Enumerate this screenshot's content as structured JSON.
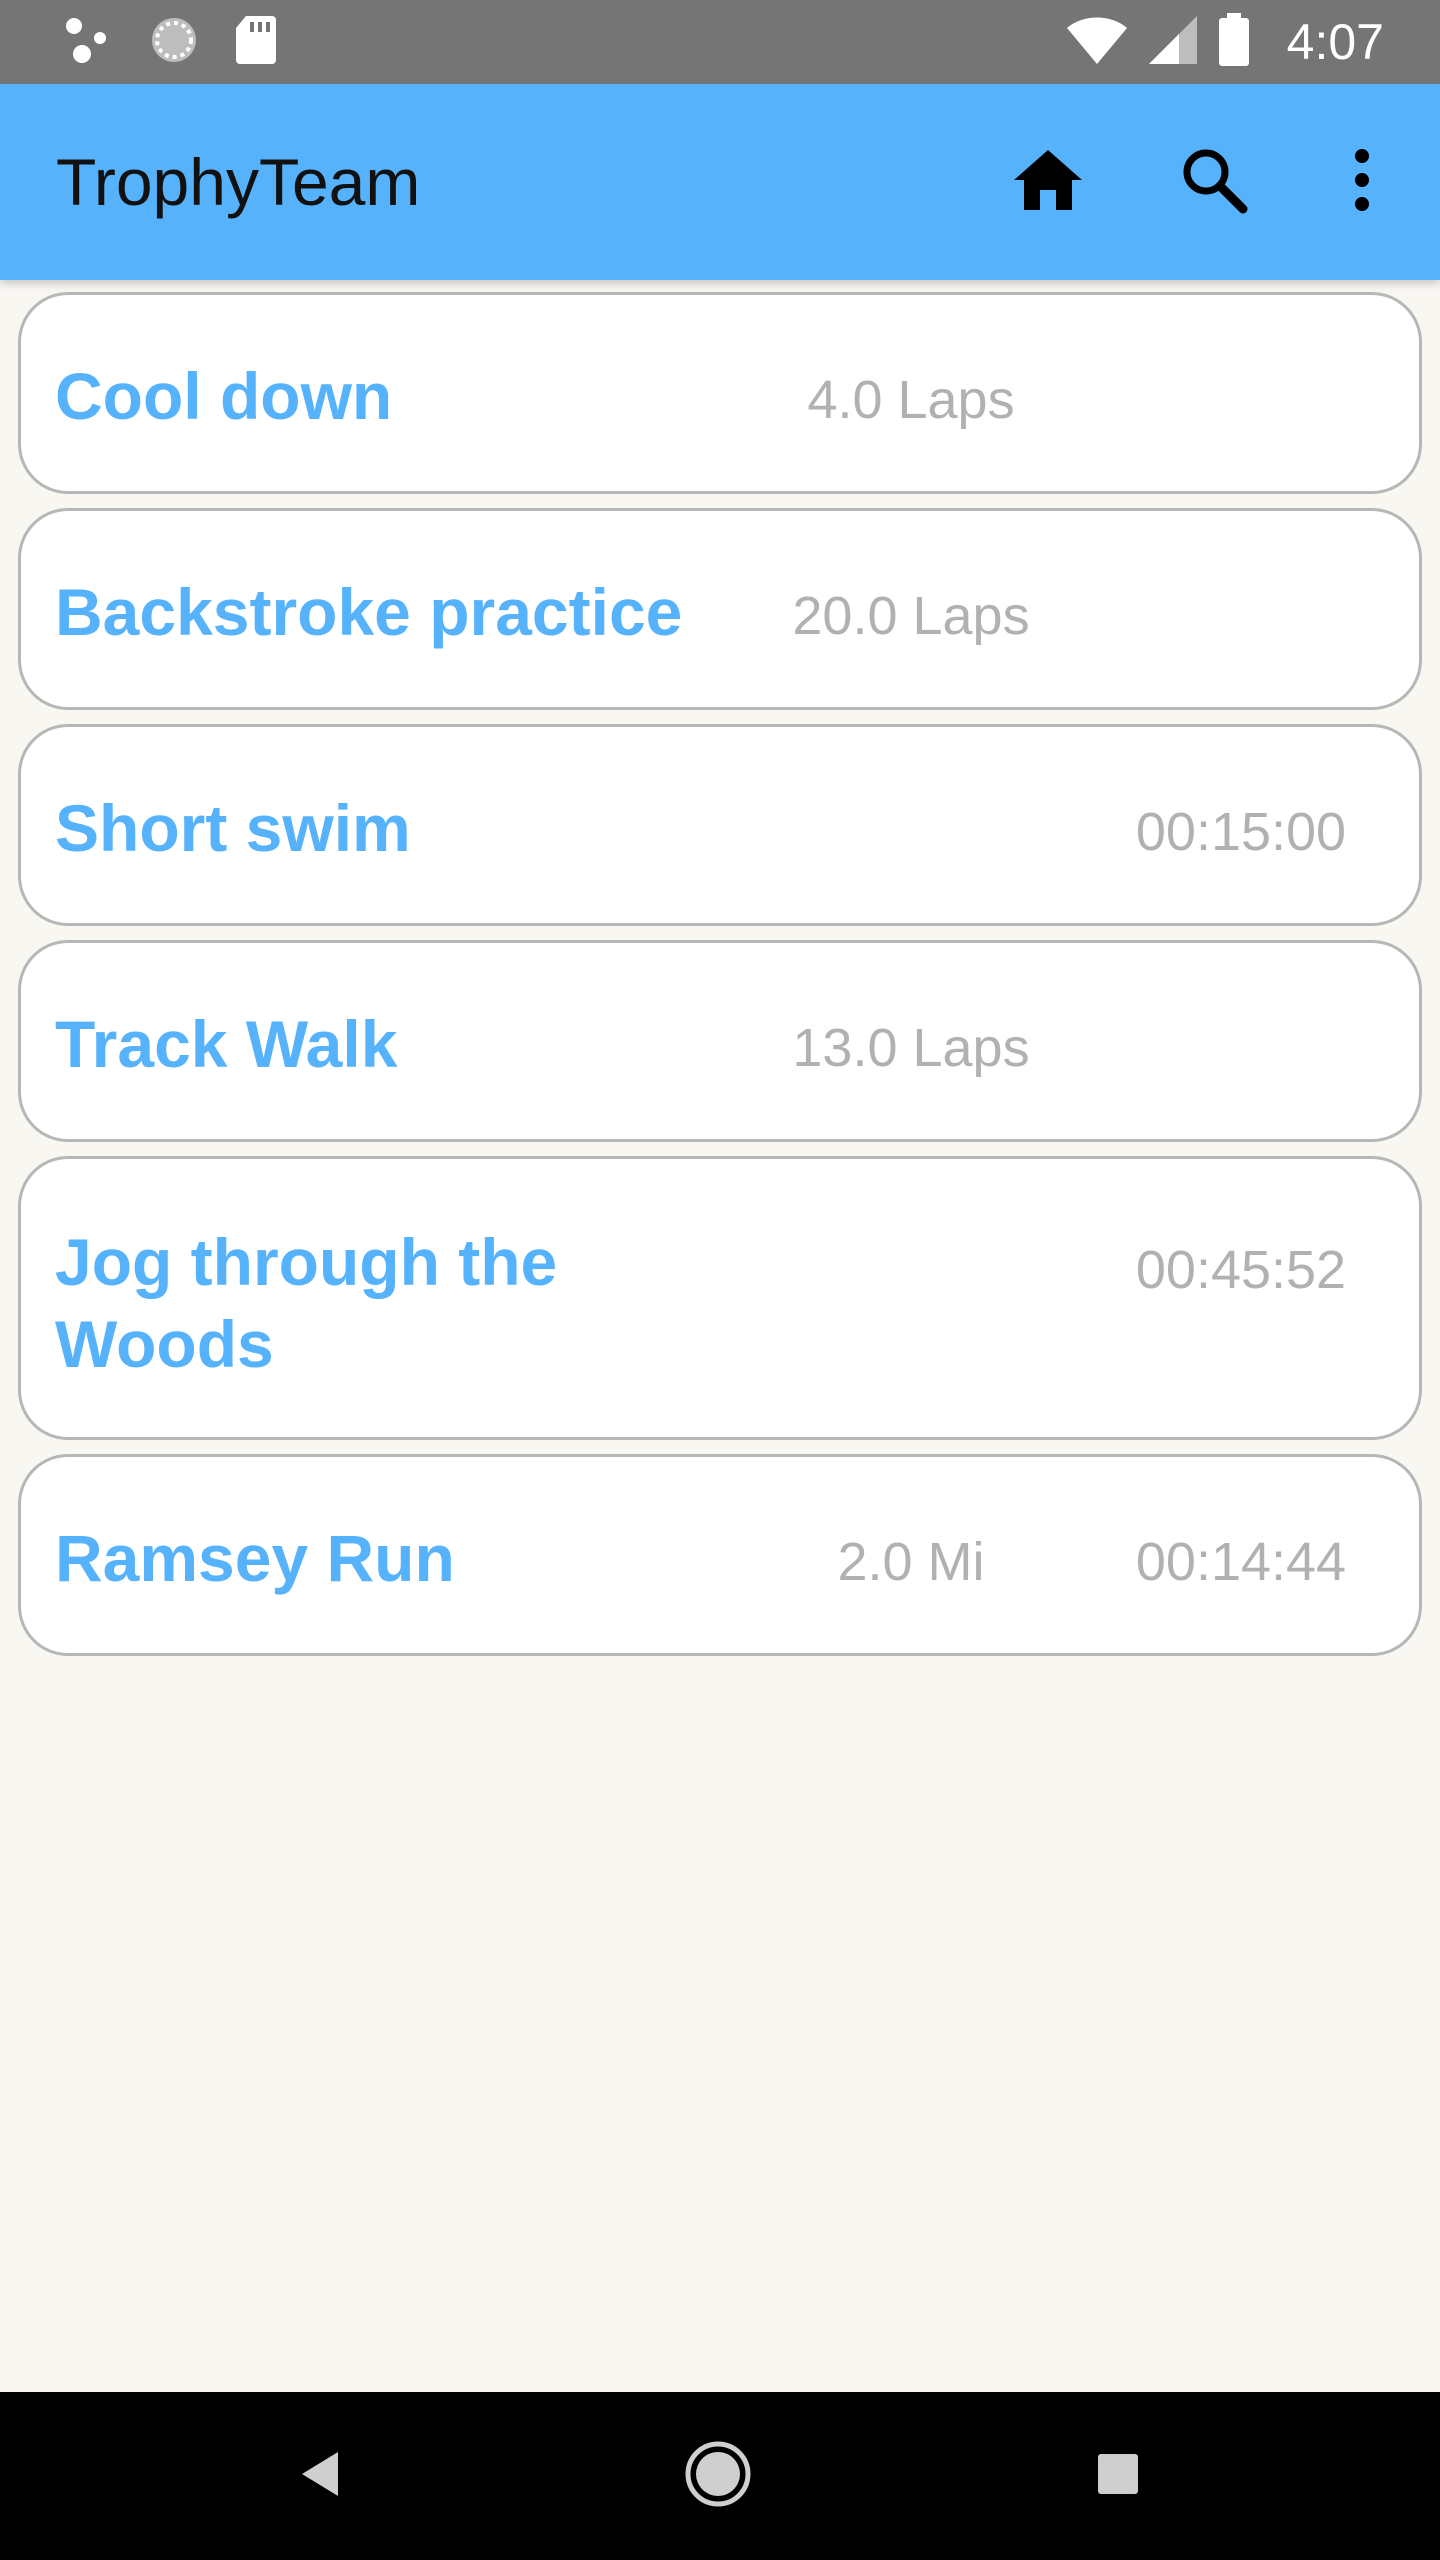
{
  "status_bar": {
    "time": "4:07",
    "left_icons": [
      "assistant-dots-icon",
      "sync-loading-icon",
      "sd-card-icon"
    ],
    "right_icons": [
      "wifi-icon",
      "cell-signal-icon",
      "battery-icon"
    ]
  },
  "app_bar": {
    "title": "TrophyTeam",
    "actions": [
      "home-icon",
      "search-icon",
      "overflow-menu-icon"
    ]
  },
  "workouts": [
    {
      "title": "Cool down",
      "distance": "4.0 Laps",
      "duration": ""
    },
    {
      "title": "Backstroke practice",
      "distance": "20.0 Laps",
      "duration": ""
    },
    {
      "title": "Short swim",
      "distance": "",
      "duration": "00:15:00"
    },
    {
      "title": "Track Walk",
      "distance": "13.0 Laps",
      "duration": ""
    },
    {
      "title": "Jog through the Woods",
      "distance": "",
      "duration": "00:45:52"
    },
    {
      "title": "Ramsey Run",
      "distance": "2.0 Mi",
      "duration": "00:14:44"
    }
  ],
  "nav_bar": {
    "buttons": [
      "back-icon",
      "home-circle-icon",
      "recents-icon"
    ]
  },
  "colors": {
    "status_bar": "#757575",
    "app_bar": "#56b2fb",
    "accent_text": "#56b2fb",
    "muted_text": "#b1b1b1",
    "card_border": "#b7b7b7",
    "background": "#f9f7f2",
    "nav_bar": "#000000"
  }
}
